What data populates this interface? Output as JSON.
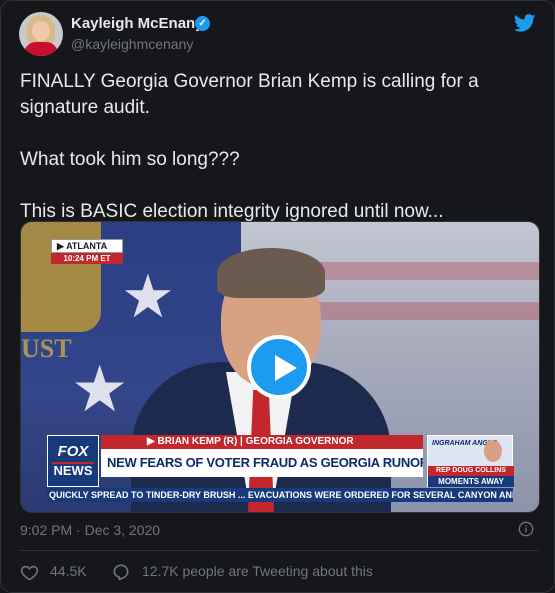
{
  "author": {
    "name": "Kayleigh McEnany",
    "handle": "@kayleighmcenany",
    "verified": true,
    "verified_icon": "verified-badge-icon"
  },
  "brand_icon": "twitter-bird-icon",
  "tweet": {
    "paragraphs": [
      "FINALLY Georgia Governor Brian Kemp is calling for a signature audit.",
      "What took him so long???",
      "This is BASIC election integrity ignored until now..."
    ]
  },
  "media": {
    "type": "video",
    "play_icon": "play-icon",
    "seal_text": "UST",
    "location_tag": {
      "arrow": "▶",
      "city": "ATLANTA",
      "time": "10:24 PM ET"
    },
    "network_logo": {
      "line1": "FOX",
      "line2": "NEWS"
    },
    "chyron_name": "▶ BRIAN KEMP (R) | GEORGIA GOVERNOR",
    "chyron_headline": "NEW FEARS OF VOTER FRAUD AS GEORGIA RUNOFF NEARS",
    "promo": {
      "show": "INGRAHAM ANGLE",
      "guest": "REP DOUG COLLINS",
      "tag": "MOMENTS AWAY"
    },
    "ticker": "QUICKLY SPREAD TO TINDER-DRY BRUSH ...  EVACUATIONS WERE ORDERED FOR SEVERAL CANYON AND I"
  },
  "meta": {
    "timestamp": "9:02 PM · Dec 3, 2020",
    "info_icon": "info-icon"
  },
  "actions": {
    "likes": "44.5K",
    "like_icon": "heart-icon",
    "conversation": "12.7K people are Tweeting about this",
    "conversation_icon": "speech-bubble-icon"
  },
  "colors": {
    "background": "#15171a",
    "text": "#e7e9ea",
    "secondary_text": "#71767b",
    "accent": "#1d9bf0",
    "border": "#2f3336"
  }
}
